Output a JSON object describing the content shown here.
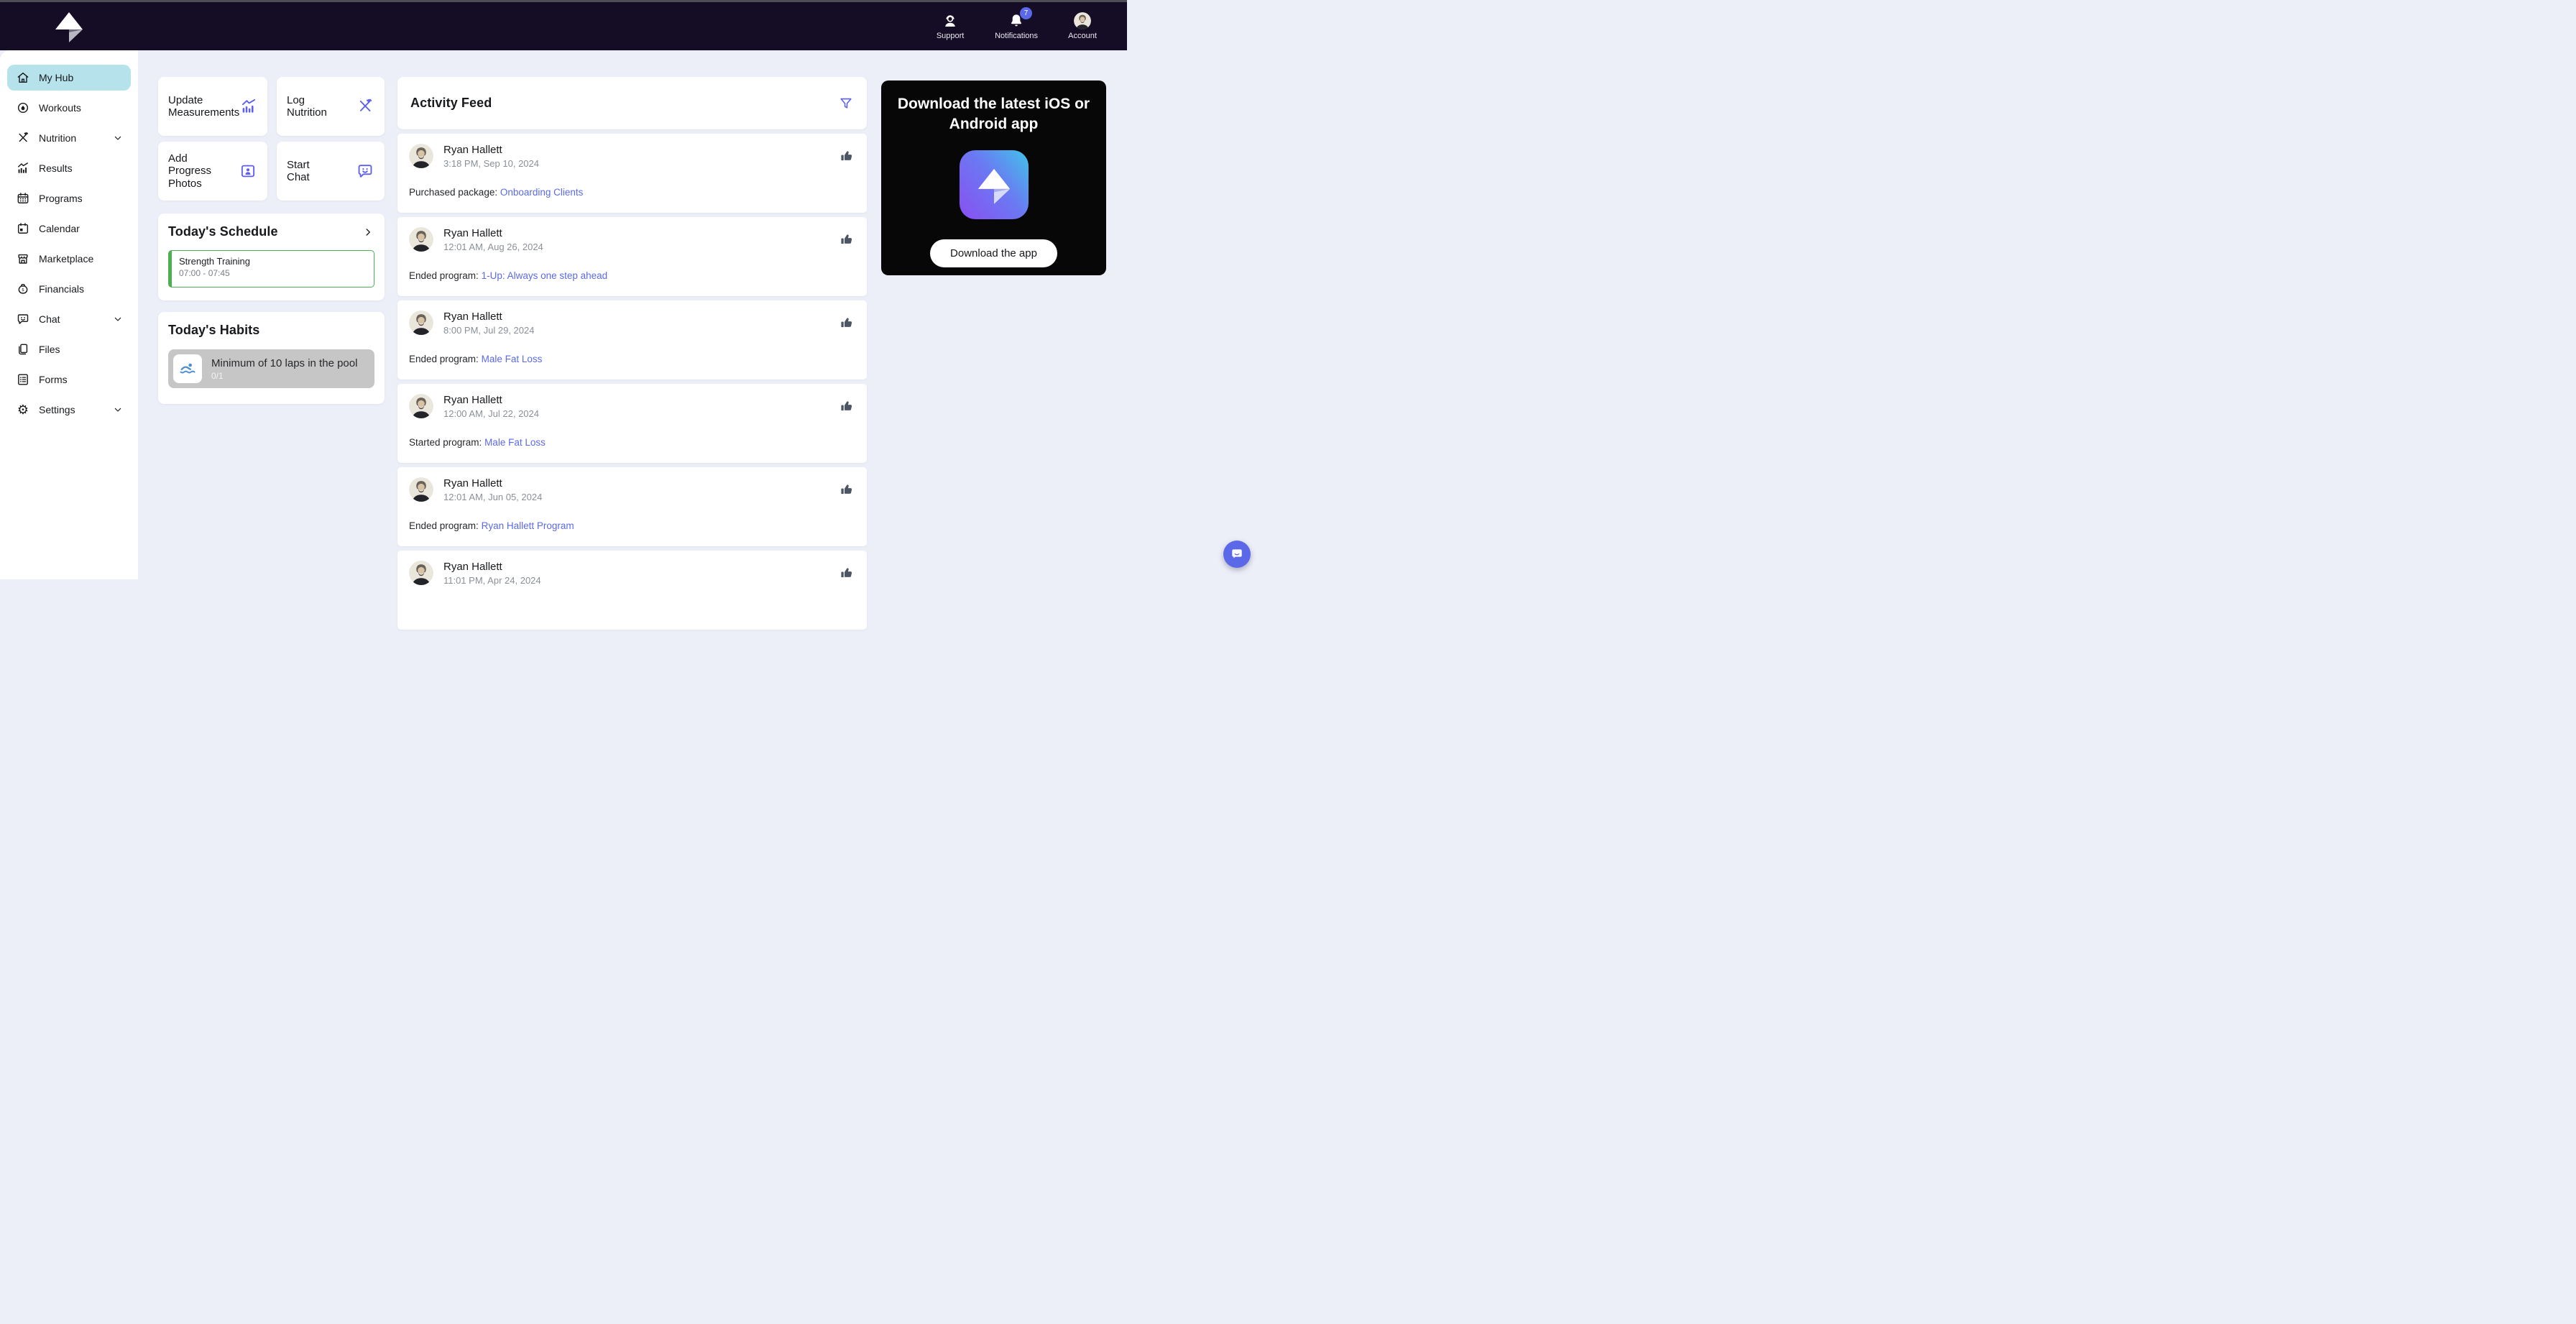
{
  "topbar": {
    "support_label": "Support",
    "notifications_label": "Notifications",
    "notifications_badge": "7",
    "account_label": "Account"
  },
  "sidebar": {
    "items": [
      {
        "label": "My Hub",
        "icon": "home-icon",
        "active": true
      },
      {
        "label": "Workouts",
        "icon": "workouts-icon"
      },
      {
        "label": "Nutrition",
        "icon": "nutrition-icon",
        "expandable": true
      },
      {
        "label": "Results",
        "icon": "results-icon"
      },
      {
        "label": "Programs",
        "icon": "programs-icon"
      },
      {
        "label": "Calendar",
        "icon": "calendar-icon"
      },
      {
        "label": "Marketplace",
        "icon": "marketplace-icon"
      },
      {
        "label": "Financials",
        "icon": "financials-icon"
      },
      {
        "label": "Chat",
        "icon": "chat-icon",
        "expandable": true
      },
      {
        "label": "Files",
        "icon": "files-icon"
      },
      {
        "label": "Forms",
        "icon": "forms-icon"
      },
      {
        "label": "Settings",
        "icon": "settings-icon",
        "expandable": true
      }
    ]
  },
  "quick_actions": [
    {
      "line1": "Update",
      "line2": "Measurements",
      "icon": "measurements-chart-icon"
    },
    {
      "line1": "Log",
      "line2": "Nutrition",
      "icon": "nutrition-icon"
    },
    {
      "line1": "Add",
      "line2": "Progress Photos",
      "icon": "progress-photos-icon"
    },
    {
      "line1": "Start",
      "line2": "Chat",
      "icon": "chat-icon"
    }
  ],
  "schedule": {
    "title": "Today's Schedule",
    "event": {
      "title": "Strength Training",
      "time": "07:00 - 07:45"
    }
  },
  "habits": {
    "title": "Today's Habits",
    "item": {
      "label": "Minimum of 10 laps in the pool",
      "progress": "0/1",
      "icon": "swimmer-icon"
    }
  },
  "feed": {
    "title": "Activity Feed",
    "items": [
      {
        "name": "Ryan Hallett",
        "timestamp": "3:18 PM, Sep 10, 2024",
        "action": "Purchased package:",
        "link": "Onboarding Clients"
      },
      {
        "name": "Ryan Hallett",
        "timestamp": "12:01 AM, Aug 26, 2024",
        "action": "Ended program:",
        "link": "1-Up: Always one step ahead"
      },
      {
        "name": "Ryan Hallett",
        "timestamp": "8:00 PM, Jul 29, 2024",
        "action": "Ended program:",
        "link": "Male Fat Loss"
      },
      {
        "name": "Ryan Hallett",
        "timestamp": "12:00 AM, Jul 22, 2024",
        "action": "Started program:",
        "link": "Male Fat Loss"
      },
      {
        "name": "Ryan Hallett",
        "timestamp": "12:01 AM, Jun 05, 2024",
        "action": "Ended program:",
        "link": "Ryan Hallett Program"
      },
      {
        "name": "Ryan Hallett",
        "timestamp": "11:01 PM, Apr 24, 2024"
      }
    ]
  },
  "download_card": {
    "title": "Download the latest iOS or Android app",
    "button_label": "Download the app"
  },
  "colors": {
    "topbar_bg": "#150d26",
    "accent_purple": "#5d5fef",
    "link_blue": "#5b6ae8",
    "active_item_bg": "#b6e2ec",
    "event_green": "#4caf50",
    "badge_bg": "#5b68e8",
    "habit_gray": "#c6c6c6",
    "main_bg": "#edeff8"
  }
}
